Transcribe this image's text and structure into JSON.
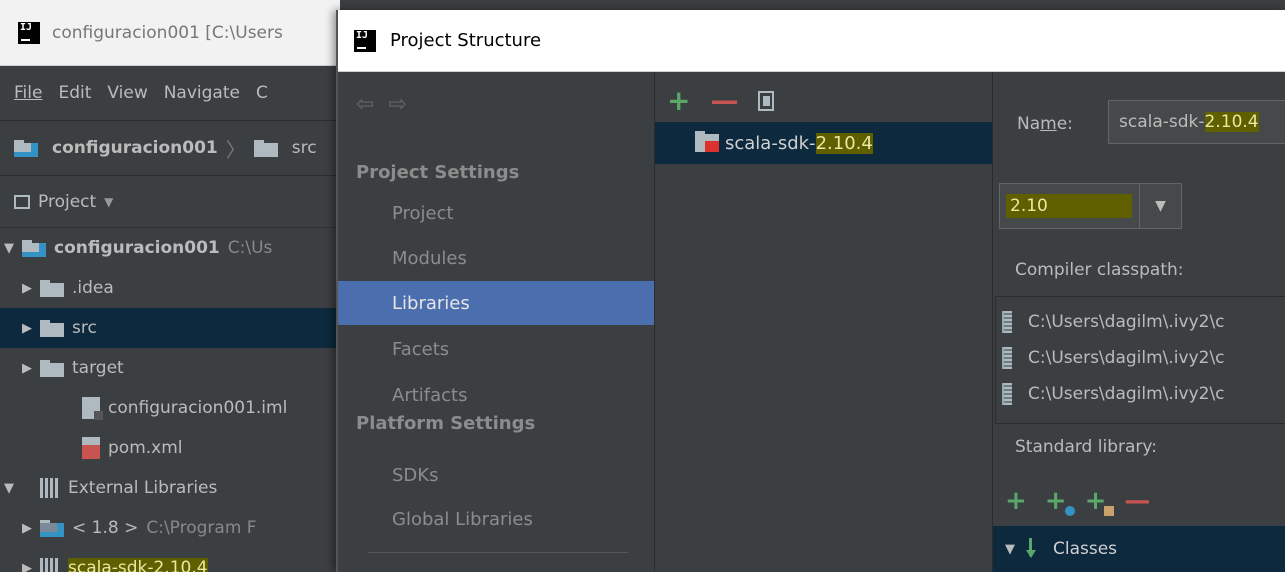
{
  "ide": {
    "window_title": "configuracion001 [C:\\Users",
    "menu": [
      {
        "label": "File"
      },
      {
        "label": "Edit"
      },
      {
        "label": "View"
      },
      {
        "label": "Navigate"
      },
      {
        "label": "C"
      }
    ],
    "breadcrumb": {
      "project": "configuracion001",
      "folder": "src"
    },
    "project_view_label": "Project",
    "tree": [
      {
        "label": "configuracion001",
        "path": "C:\\Us"
      },
      {
        "label": ".idea"
      },
      {
        "label": "src"
      },
      {
        "label": "target"
      },
      {
        "label": "configuracion001.iml"
      },
      {
        "label": "pom.xml"
      },
      {
        "label": "External Libraries"
      },
      {
        "label": "< 1.8 >",
        "path": "C:\\Program F"
      },
      {
        "label": "scala-sdk-2.10.4"
      }
    ]
  },
  "dialog": {
    "title": "Project Structure",
    "project_settings_header": "Project Settings",
    "platform_settings_header": "Platform Settings",
    "nav_items": [
      {
        "label": "Project"
      },
      {
        "label": "Modules"
      },
      {
        "label": "Libraries"
      },
      {
        "label": "Facets"
      },
      {
        "label": "Artifacts"
      },
      {
        "label": "SDKs"
      },
      {
        "label": "Global Libraries"
      }
    ],
    "selected_nav": "Libraries",
    "library": {
      "name_prefix": "scala-sdk-",
      "name_version": "2.10.4"
    },
    "detail": {
      "name_label_pre": "Na",
      "name_label_u": "m",
      "name_label_post": "e:",
      "name_value_prefix": "scala-sdk-",
      "name_value_version": "2.10.4",
      "version_selected": "2.10",
      "compiler_classpath_label": "Compiler classpath:",
      "classpath": [
        "C:\\Users\\dagilm\\.ivy2\\c",
        "C:\\Users\\dagilm\\.ivy2\\c",
        "C:\\Users\\dagilm\\.ivy2\\c"
      ],
      "standard_library_label": "Standard library:",
      "classes_label": "Classes"
    }
  },
  "colors": {
    "highlight": "#5f5f00",
    "selection": "#4b6eaf",
    "tree_selection": "#0d293e",
    "add_green": "#59a869",
    "remove_red": "#c75450"
  }
}
